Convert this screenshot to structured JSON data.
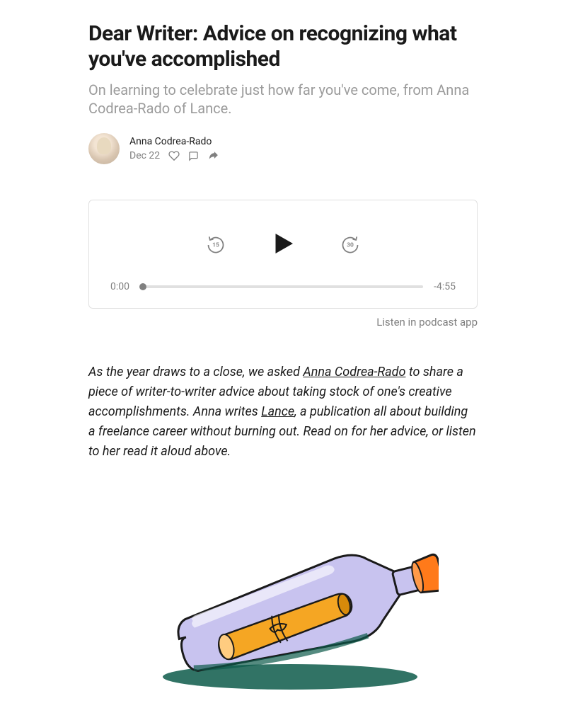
{
  "article": {
    "title": "Dear Writer: Advice on recognizing what you've accomplished",
    "subtitle": "On learning to celebrate just how far you've come, from Anna Codrea-Rado of Lance."
  },
  "byline": {
    "author": "Anna Codrea-Rado",
    "date": "Dec 22"
  },
  "player": {
    "rewind_label": "15",
    "forward_label": "30",
    "time_elapsed": "0:00",
    "time_remaining": "-4:55"
  },
  "listen_link": "Listen in podcast app",
  "intro": {
    "part1": "As the year draws to a close, we asked ",
    "link1": "Anna Codrea-Rado",
    "part2": " to share a piece of writer-to-writer advice about taking stock of one's creative accomplishments. Anna writes ",
    "link2": "Lance",
    "part3": ", a publication all about building a freelance career without burning out. Read on for her advice, or listen to her read it aloud above."
  }
}
